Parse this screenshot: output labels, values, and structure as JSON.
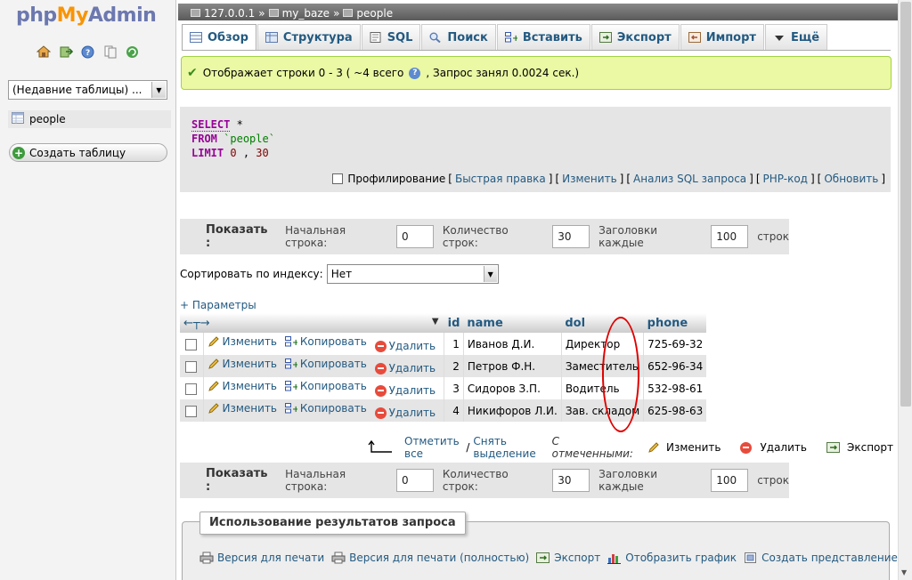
{
  "sidebar": {
    "logo": {
      "php": "php",
      "my": "My",
      "admin": "Admin"
    },
    "nav_icons": [
      "home-icon",
      "exit-icon",
      "help-icon",
      "docs-icon",
      "reload-icon"
    ],
    "recent_select": "(Недавние таблицы) ...",
    "tree_items": [
      {
        "label": "people"
      }
    ],
    "create_table_label": "Создать таблицу"
  },
  "breadcrumb": {
    "server": "127.0.0.1",
    "sep": "»",
    "database": "my_baze",
    "table": "people"
  },
  "tabs": [
    {
      "label": "Обзор",
      "icon": "browse-icon",
      "active": true
    },
    {
      "label": "Структура",
      "icon": "structure-icon"
    },
    {
      "label": "SQL",
      "icon": "sql-icon"
    },
    {
      "label": "Поиск",
      "icon": "search-icon"
    },
    {
      "label": "Вставить",
      "icon": "insert-icon"
    },
    {
      "label": "Экспорт",
      "icon": "export-icon"
    },
    {
      "label": "Импорт",
      "icon": "import-icon"
    },
    {
      "label": "Ещё",
      "icon": "more-icon"
    }
  ],
  "notice": {
    "text_before": "Отображает строки 0 - 3 ( ~4 всего",
    "text_after": ", Запрос занял 0.0024 сек.)"
  },
  "sql": {
    "select": "SELECT",
    "star": "*",
    "from": "FROM",
    "table": "`people`",
    "limit": "LIMIT",
    "offset": "0",
    "comma": ",",
    "count": "30"
  },
  "sql_links": {
    "profiling": "Профилирование",
    "quick_edit": "Быстрая правка",
    "edit": "Изменить",
    "analyze": "Анализ SQL запроса",
    "php_code": "PHP-код",
    "refresh": "Обновить"
  },
  "navbar": {
    "show": "Показать :",
    "start_label": "Начальная строка:",
    "start_value": "0",
    "count_label": "Количество строк:",
    "count_value": "30",
    "headers_label": "Заголовки каждые",
    "headers_value": "100",
    "rows_suffix": "строк"
  },
  "sort": {
    "label": "Сортировать по индексу:",
    "value": "Нет"
  },
  "params_link": "+ Параметры",
  "table": {
    "columns": [
      "id",
      "name",
      "dol",
      "phone"
    ],
    "action_labels": {
      "edit": "Изменить",
      "copy": "Копировать",
      "delete": "Удалить"
    },
    "rows": [
      {
        "id": "1",
        "name": "Иванов Д.И.",
        "dol": "Директор",
        "phone": "725-69-32"
      },
      {
        "id": "2",
        "name": "Петров Ф.Н.",
        "dol": "Заместитель",
        "phone": "652-96-34"
      },
      {
        "id": "3",
        "name": "Сидоров З.П.",
        "dol": "Водитель",
        "phone": "532-98-61"
      },
      {
        "id": "4",
        "name": "Никифоров Л.И.",
        "dol": "Зав. складом",
        "phone": "625-98-63"
      }
    ]
  },
  "with_selected": {
    "check_all": "Отметить все",
    "sep": "/",
    "uncheck_all": "Снять выделение",
    "with_selected": "С отмеченными:",
    "edit": "Изменить",
    "delete": "Удалить",
    "export": "Экспорт"
  },
  "query_results": {
    "legend": "Использование результатов запроса",
    "print": "Версия для печати",
    "print_full": "Версия для печати (полностью)",
    "export": "Экспорт",
    "chart": "Отобразить график",
    "create_view": "Создать представление"
  },
  "colors": {
    "link": "#235a81",
    "notice_bg": "#ebf8a4",
    "annotation": "#e00000"
  }
}
